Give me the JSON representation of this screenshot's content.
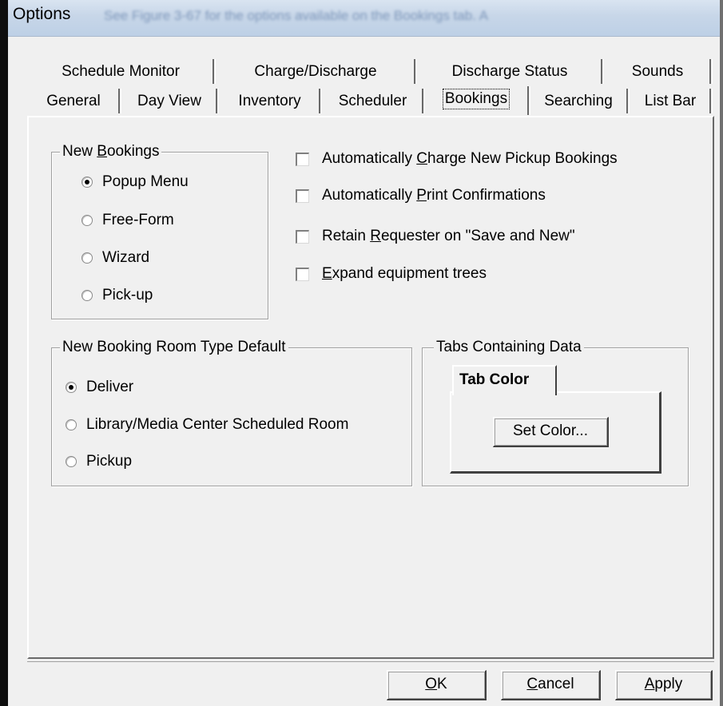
{
  "window": {
    "title": "Options",
    "title_overlay_text": "See Figure 3-67 for the options available on the Bookings tab. A"
  },
  "tabs": {
    "row1": [
      {
        "label": "Schedule Monitor"
      },
      {
        "label": "Charge/Discharge"
      },
      {
        "label": "Discharge Status"
      },
      {
        "label": "Sounds"
      }
    ],
    "row2": [
      {
        "label": "General"
      },
      {
        "label": "Day View"
      },
      {
        "label": "Inventory"
      },
      {
        "label": "Scheduler"
      },
      {
        "label": "Bookings",
        "selected": true
      },
      {
        "label": "Searching"
      },
      {
        "label": "List Bar"
      }
    ]
  },
  "new_bookings": {
    "title_prefix": "New ",
    "title_access": "B",
    "title_suffix": "ookings",
    "options": [
      {
        "label": "Popup Menu",
        "checked": true
      },
      {
        "label": "Free-Form",
        "checked": false
      },
      {
        "label": "Wizard",
        "checked": false
      },
      {
        "label": "Pick-up",
        "checked": false
      }
    ]
  },
  "checkboxes": [
    {
      "pre": "Automatically ",
      "access": "C",
      "post": "harge New Pickup Bookings",
      "checked": false
    },
    {
      "pre": "Automatically ",
      "access": "P",
      "post": "rint Confirmations",
      "checked": false
    },
    {
      "pre": "Retain ",
      "access": "R",
      "post": "equester on \"Save and New\"",
      "checked": false
    },
    {
      "pre": "",
      "access": "E",
      "post": "xpand equipment trees",
      "checked": false
    }
  ],
  "room_type": {
    "title": "New Booking Room Type Default",
    "options": [
      {
        "label": "Deliver",
        "checked": true
      },
      {
        "label": "Library/Media Center Scheduled Room",
        "checked": false
      },
      {
        "label": "Pickup",
        "checked": false
      }
    ]
  },
  "tabs_data": {
    "title": "Tabs Containing Data",
    "tab_label": "Tab Color",
    "set_color_label": "Set Color..."
  },
  "buttons": {
    "ok": {
      "access": "O",
      "rest": "K"
    },
    "cancel": {
      "access": "C",
      "rest": "ancel"
    },
    "apply": {
      "access": "A",
      "rest": "pply"
    }
  },
  "colors": {
    "title_bar": "#c7d6e8",
    "dialog_bg": "#f0f0f0",
    "frame_dark": "#0e0e0e"
  }
}
